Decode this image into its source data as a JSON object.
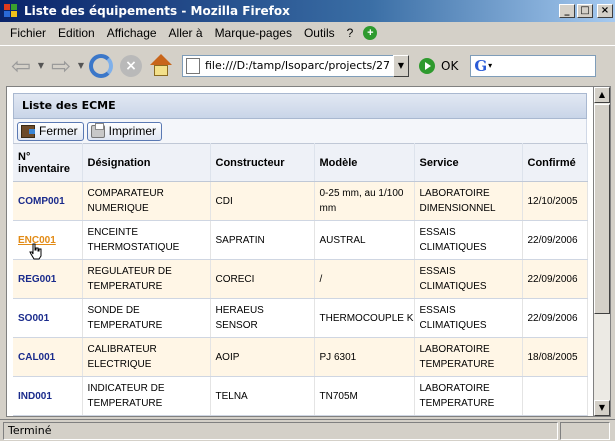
{
  "window": {
    "title": "Liste des équipements - Mozilla Firefox",
    "controls": {
      "minimize": "_",
      "maximize": "□",
      "close": "×"
    }
  },
  "menu": {
    "items": [
      {
        "label": "Fichier"
      },
      {
        "label": "Edition"
      },
      {
        "label": "Affichage"
      },
      {
        "label": "Aller à"
      },
      {
        "label": "Marque-pages"
      },
      {
        "label": "Outils"
      },
      {
        "label": "?"
      }
    ]
  },
  "navbar": {
    "url": "file:///D:/tamp/Isoparc/projects/27",
    "go_label": "OK",
    "search_value": ""
  },
  "page": {
    "panel_title": "Liste des ECME",
    "buttons": {
      "close": "Fermer",
      "print": "Imprimer"
    },
    "columns": [
      "N° inventaire",
      "Désignation",
      "Constructeur",
      "Modèle",
      "Service",
      "Confirmé"
    ],
    "rows": [
      {
        "code": "COMP001",
        "designation": "COMPARATEUR NUMERIQUE",
        "maker": "CDI",
        "model": "0-25 mm, au 1/100 mm",
        "service": "LABORATOIRE DIMENSIONNEL",
        "confirmed": "12/10/2005"
      },
      {
        "code": "ENC001",
        "designation": "ENCEINTE THERMOSTATIQUE",
        "maker": "SAPRATIN",
        "model": "AUSTRAL",
        "service": "ESSAIS CLIMATIQUES",
        "confirmed": "22/09/2006"
      },
      {
        "code": "REG001",
        "designation": "REGULATEUR DE TEMPERATURE",
        "maker": "CORECI",
        "model": "/",
        "service": "ESSAIS CLIMATIQUES",
        "confirmed": "22/09/2006"
      },
      {
        "code": "SO001",
        "designation": "SONDE DE TEMPERATURE",
        "maker": "HERAEUS SENSOR",
        "model": "THERMOCOUPLE K",
        "service": "ESSAIS CLIMATIQUES",
        "confirmed": "22/09/2006"
      },
      {
        "code": "CAL001",
        "designation": "CALIBRATEUR ELECTRIQUE",
        "maker": "AOIP",
        "model": "PJ 6301",
        "service": "LABORATOIRE TEMPERATURE",
        "confirmed": "18/08/2005"
      },
      {
        "code": "IND001",
        "designation": "INDICATEUR DE TEMPERATURE",
        "maker": "TELNA",
        "model": "TN705M",
        "service": "LABORATOIRE TEMPERATURE",
        "confirmed": ""
      }
    ]
  },
  "status": {
    "text": "Terminé"
  }
}
